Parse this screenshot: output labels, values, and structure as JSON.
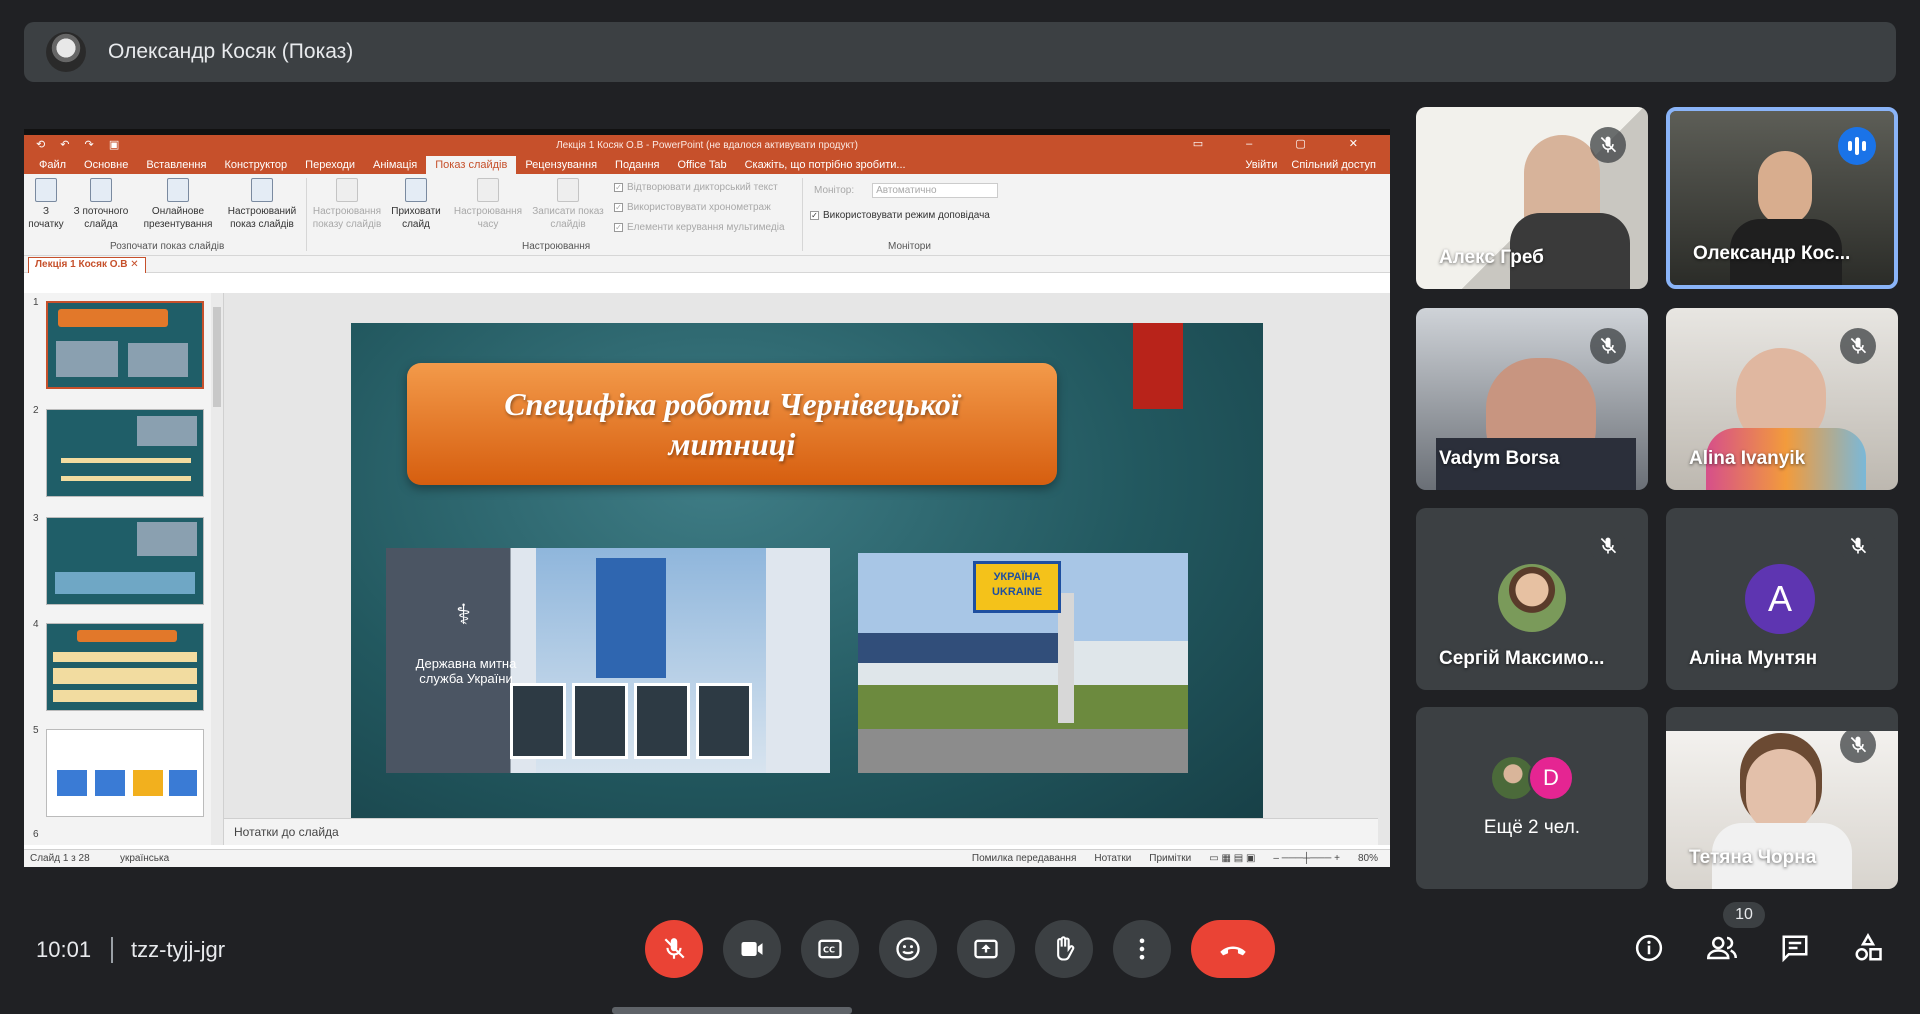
{
  "presenter": {
    "name": "Олександр Косяк (Показ)"
  },
  "powerpoint": {
    "window_title": "Лекція 1 Косяк О.В - PowerPoint (не вдалося активувати продукт)",
    "menu": [
      "Файл",
      "Основне",
      "Вставлення",
      "Конструктор",
      "Переходи",
      "Анімація",
      "Показ слайдів",
      "Рецензування",
      "Подання",
      "Office Tab",
      "Скажіть, що потрібно зробити..."
    ],
    "active_menu": "Показ слайдів",
    "signin": "Увійти",
    "share": "Спільний доступ",
    "ribbon": {
      "from_start": "З початку",
      "from_current": "З поточного слайда",
      "online": "Онлайнове презентування",
      "custom": "Настроюваний показ слайдів",
      "group_start": "Розпочати показ слайдів",
      "setup": "Настроювання показу слайдів",
      "hide": "Приховати слайд",
      "rehearse": "Настроювання часу",
      "record": "Записати показ слайдів",
      "play_narrations": "Відтворювати дикторський текст",
      "use_timings": "Використовувати хронометраж",
      "media_controls": "Елементи керування мультимедіа",
      "group_setup": "Настроювання",
      "monitor_label": "Монітор:",
      "monitor_value": "Автоматично",
      "presenter_view": "Використовувати режим доповідача",
      "group_monitors": "Монітори"
    },
    "doc_tab": "Лекція 1 Косяк О.В",
    "slide_numbers": [
      "1",
      "2",
      "3",
      "4",
      "5",
      "6"
    ],
    "slide": {
      "title_line1": "Специфіка роботи Чернівецької",
      "title_line2": "митниці",
      "photo1_caption": "Державна митна служба України",
      "sign_line1": "УКРАЇНА",
      "sign_line2": "UKRAINE"
    },
    "notes_placeholder": "Нотатки до слайда",
    "status": {
      "slide_of": "Слайд 1 з 28",
      "language": "українська",
      "error": "Помилка передавання",
      "notes": "Нотатки",
      "comments": "Примітки",
      "zoom": "80%"
    }
  },
  "participants": [
    {
      "name": "Алекс Греб",
      "muted": true
    },
    {
      "name": "Олександр Кос...",
      "speaking": true
    },
    {
      "name": "Vadym Borsa",
      "muted": true
    },
    {
      "name": "Alina Ivanyik",
      "muted": true
    },
    {
      "name": "Сергій Максимо...",
      "muted": true
    },
    {
      "name": "Аліна Мунтян",
      "muted": true,
      "initial": "A"
    },
    {
      "name": "Ещё 2 чел.",
      "initial": "D"
    },
    {
      "name": "Тетяна Чорна",
      "muted": true
    }
  ],
  "meeting": {
    "time": "10:01",
    "code": "tzz-tyjj-jgr",
    "participant_count": "10"
  },
  "colors": {
    "end_call": "#ea4335",
    "speaking": "#1a73e8",
    "ppt_accent": "#c6502b"
  }
}
